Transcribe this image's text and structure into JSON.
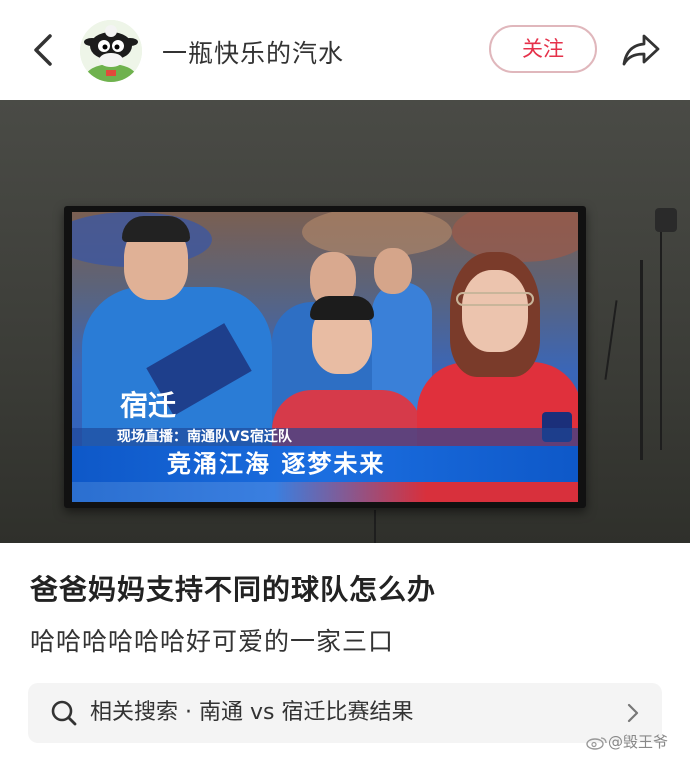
{
  "header": {
    "username": "一瓶快乐的汽水",
    "follow_label": "关注"
  },
  "tv": {
    "caption_small": "现场直播：南通队VS宿迁队",
    "caption_main": "竞涌江海  逐梦未来",
    "shirt_text": "宿迁"
  },
  "post": {
    "title": "爸爸妈妈支持不同的球队怎么办",
    "body": "哈哈哈哈哈哈好可爱的一家三口"
  },
  "related": {
    "label": "相关搜索 · 南通 vs 宿迁比赛结果"
  },
  "watermark": {
    "text": "@毁王爷"
  },
  "colors": {
    "accent": "#e5314a",
    "follow_border": "#e0b7bc",
    "caption_blue": "#1b6ee0"
  },
  "icons": [
    "back-arrow-icon",
    "share-icon",
    "search-icon",
    "chevron-right-icon",
    "weibo-icon"
  ]
}
